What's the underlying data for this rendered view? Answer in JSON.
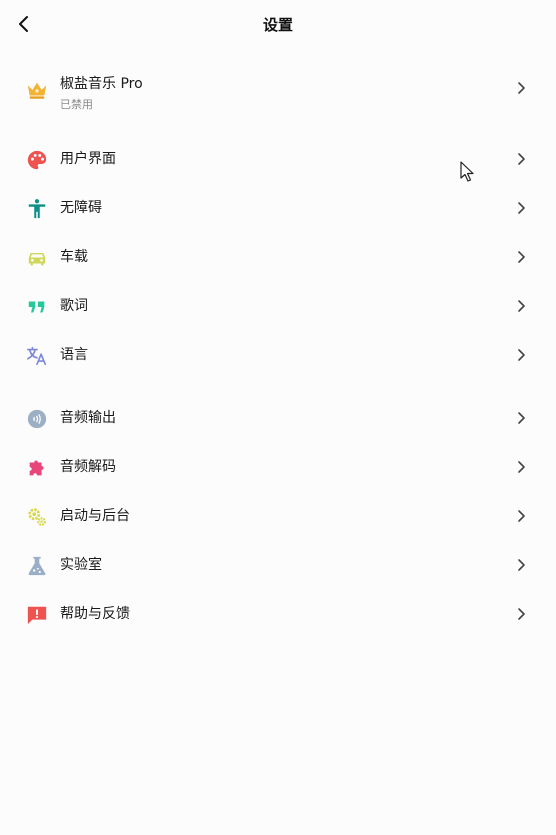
{
  "header": {
    "title": "设置"
  },
  "pro": {
    "title": "椒盐音乐 Pro",
    "status": "已禁用"
  },
  "items": [
    {
      "label": "用户界面",
      "icon": "palette-icon",
      "color": "#ef5350"
    },
    {
      "label": "无障碍",
      "icon": "accessibility-icon",
      "color": "#0b8f86"
    },
    {
      "label": "车载",
      "icon": "car-icon",
      "color": "#cfd85a"
    },
    {
      "label": "歌词",
      "icon": "quote-icon",
      "color": "#28c79a"
    },
    {
      "label": "语言",
      "icon": "translate-icon",
      "color": "#7b88d8"
    },
    {
      "label": "音频输出",
      "icon": "speaker-icon",
      "color": "#9cafc4"
    },
    {
      "label": "音频解码",
      "icon": "puzzle-icon",
      "color": "#e8457a"
    },
    {
      "label": "启动与后台",
      "icon": "gears-icon",
      "color": "#d8d64a"
    },
    {
      "label": "实验室",
      "icon": "flask-icon",
      "color": "#9aaec6"
    },
    {
      "label": "帮助与反馈",
      "icon": "feedback-icon",
      "color": "#ef5350"
    }
  ],
  "colors": {
    "crown": "#f2b233",
    "chevron": "#444444"
  }
}
